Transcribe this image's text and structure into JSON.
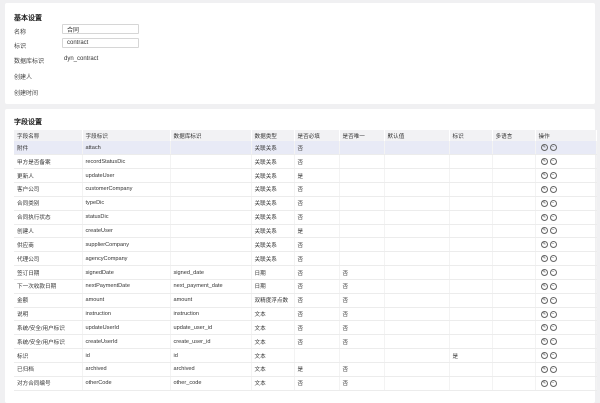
{
  "basic": {
    "title": "基本设置",
    "name_label": "名称",
    "name_value": "合同",
    "id_label": "标识",
    "id_value": "contract",
    "db_label": "数据库标识",
    "db_value": "dyn_contract",
    "creator_label": "创建人",
    "created_time_label": "创建时间"
  },
  "fields": {
    "title": "字段设置",
    "headers": [
      "字段名称",
      "字段标识",
      "数据库标识",
      "数据类型",
      "是否必填",
      "是否唯一",
      "默认值",
      "标识",
      "多语言",
      "操作"
    ],
    "rows": [
      [
        "附件",
        "attach",
        "",
        "关联关系",
        "否",
        "",
        "",
        "",
        ""
      ],
      [
        "甲方是否备案",
        "recordStatusDic",
        "",
        "关联关系",
        "否",
        "",
        "",
        "",
        ""
      ],
      [
        "更新人",
        "updateUser",
        "",
        "关联关系",
        "是",
        "",
        "",
        "",
        ""
      ],
      [
        "客户公司",
        "customerCompany",
        "",
        "关联关系",
        "否",
        "",
        "",
        "",
        ""
      ],
      [
        "合同类别",
        "typeDic",
        "",
        "关联关系",
        "否",
        "",
        "",
        "",
        ""
      ],
      [
        "合同执行状态",
        "statusDic",
        "",
        "关联关系",
        "否",
        "",
        "",
        "",
        ""
      ],
      [
        "创建人",
        "createUser",
        "",
        "关联关系",
        "是",
        "",
        "",
        "",
        ""
      ],
      [
        "供应商",
        "supplierCompany",
        "",
        "关联关系",
        "否",
        "",
        "",
        "",
        ""
      ],
      [
        "代理公司",
        "agencyCompany",
        "",
        "关联关系",
        "否",
        "",
        "",
        "",
        ""
      ],
      [
        "签订日期",
        "signedDate",
        "signed_date",
        "日期",
        "否",
        "否",
        "",
        "",
        ""
      ],
      [
        "下一次收款日期",
        "nextPaymentDate",
        "next_payment_date",
        "日期",
        "否",
        "否",
        "",
        "",
        ""
      ],
      [
        "金额",
        "amount",
        "amount",
        "双精度浮点数",
        "否",
        "否",
        "",
        "",
        ""
      ],
      [
        "说明",
        "instruction",
        "instruction",
        "文本",
        "否",
        "否",
        "",
        "",
        ""
      ],
      [
        "系统/安全/用户标识",
        "updateUserId",
        "update_user_id",
        "文本",
        "否",
        "否",
        "",
        "",
        ""
      ],
      [
        "系统/安全/用户标识",
        "createUserId",
        "create_user_id",
        "文本",
        "否",
        "否",
        "",
        "",
        ""
      ],
      [
        "标识",
        "id",
        "id",
        "文本",
        "",
        "",
        "",
        "是",
        ""
      ],
      [
        "已归档",
        "archived",
        "archived",
        "文本",
        "是",
        "否",
        "",
        "",
        ""
      ],
      [
        "对方合同编号",
        "otherCode",
        "other_code",
        "文本",
        "否",
        "否",
        "",
        "",
        ""
      ]
    ],
    "op_icons": [
      "edit-icon",
      "delete-icon"
    ]
  }
}
